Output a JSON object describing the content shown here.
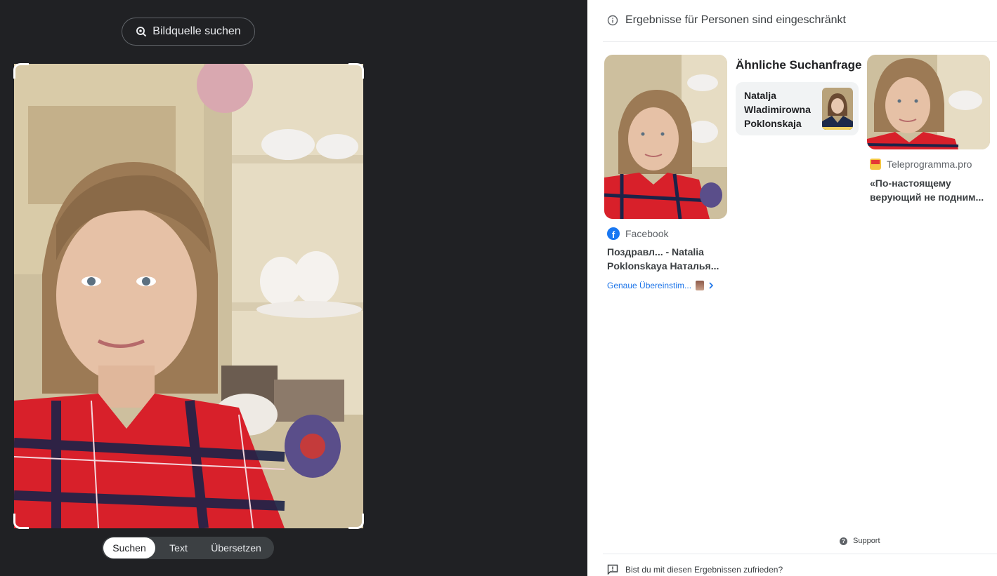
{
  "left_panel": {
    "source_button_label": "Bildquelle suchen",
    "modes": [
      "Suchen",
      "Text",
      "Übersetzen"
    ],
    "active_mode": "Suchen"
  },
  "right_panel": {
    "notice": "Ergebnisse für Personen sind eingeschränkt",
    "results": [
      {
        "source": "Facebook",
        "title_line1": "Поздравл... - Natalia",
        "title_line2": "Poklonskaya Наталья...",
        "exact_match_label": "Genaue Übereinstim..."
      },
      {
        "source": "Teleprogramma.pro",
        "title_line1": "«По-настоящему",
        "title_line2": "верующий не подним..."
      }
    ],
    "similar": {
      "heading": "Ähnliche Suchanfrage",
      "name_line1": "Natalja",
      "name_line2": "Wladimirowna",
      "name_line3": "Poklonskaja"
    },
    "support_label": "Support",
    "feedback_label": "Bist du mit diesen Ergebnissen zufrieden?"
  }
}
